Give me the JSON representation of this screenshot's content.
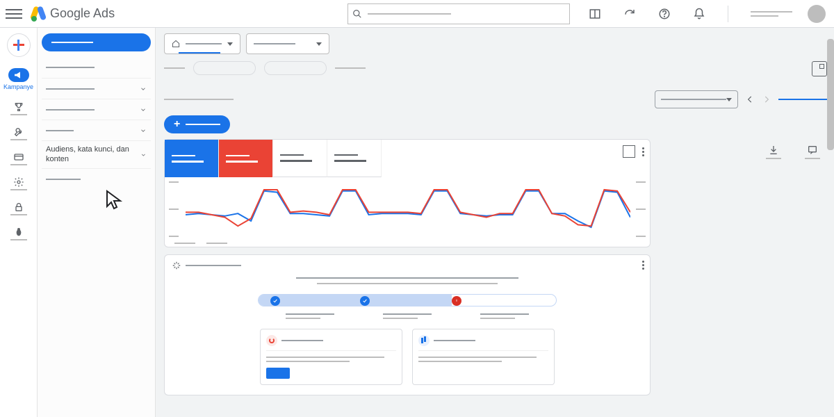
{
  "header": {
    "product_name_bold": "Google",
    "product_name_rest": " Ads",
    "search_placeholder": "",
    "icons": [
      "workspace-switch-icon",
      "refresh-icon",
      "help-icon",
      "notifications-icon"
    ]
  },
  "rail": {
    "items": [
      {
        "id": "kampanye",
        "label": "Kampanye",
        "icon": "megaphone-icon",
        "active": true
      },
      {
        "id": "goals",
        "label": "",
        "icon": "trophy-icon"
      },
      {
        "id": "tools",
        "label": "",
        "icon": "wrench-icon"
      },
      {
        "id": "billing",
        "label": "",
        "icon": "card-icon"
      },
      {
        "id": "admin",
        "label": "",
        "icon": "gear-icon"
      },
      {
        "id": "security",
        "label": "",
        "icon": "lock-icon"
      },
      {
        "id": "debug",
        "label": "",
        "icon": "bug-icon"
      }
    ]
  },
  "sidebar": {
    "items": [
      {
        "label": "",
        "type": "primary"
      },
      {
        "label": "",
        "expandable": false,
        "sep": false
      },
      {
        "label": "",
        "expandable": true
      },
      {
        "label": "",
        "expandable": true
      },
      {
        "label": "",
        "expandable": true
      },
      {
        "label": "Audiens, kata kunci, dan konten",
        "expandable": true
      },
      {
        "label": "",
        "expandable": false,
        "sep": true
      }
    ]
  },
  "toolbar": {
    "account_dropdown": "",
    "scope_dropdown": "",
    "date_range": "",
    "new_button_label": "",
    "download_label": "",
    "feedback_label": ""
  },
  "metrics": {
    "tabs": [
      {
        "id": "m1",
        "color": "blue"
      },
      {
        "id": "m2",
        "color": "red"
      },
      {
        "id": "m3",
        "color": "plain"
      },
      {
        "id": "m4",
        "color": "plain"
      }
    ]
  },
  "chart_data": {
    "type": "line",
    "x": [
      0,
      1,
      2,
      3,
      4,
      5,
      6,
      7,
      8,
      9,
      10,
      11,
      12,
      13,
      14,
      15,
      16,
      17,
      18,
      19,
      20,
      21,
      22,
      23,
      24,
      25,
      26,
      27,
      28,
      29,
      30,
      31,
      32,
      33,
      34
    ],
    "series": [
      {
        "name": "metric-1",
        "color": "#1a73e8",
        "values": [
          40,
          42,
          40,
          38,
          42,
          30,
          78,
          76,
          42,
          42,
          40,
          38,
          78,
          78,
          40,
          42,
          42,
          42,
          40,
          78,
          78,
          42,
          40,
          38,
          40,
          40,
          78,
          78,
          42,
          42,
          30,
          20,
          78,
          76,
          36
        ]
      },
      {
        "name": "metric-2",
        "color": "#ea4335",
        "values": [
          44,
          44,
          40,
          36,
          22,
          34,
          80,
          80,
          44,
          46,
          44,
          40,
          80,
          80,
          44,
          44,
          44,
          44,
          42,
          80,
          80,
          44,
          40,
          36,
          42,
          42,
          80,
          80,
          42,
          38,
          24,
          22,
          80,
          78,
          44
        ]
      }
    ],
    "ylim": [
      0,
      100
    ]
  },
  "recommendations": {
    "progress_pct": 65,
    "markers": [
      {
        "pos": 4,
        "state": "done"
      },
      {
        "pos": 34,
        "state": "done"
      },
      {
        "pos": 65,
        "state": "error"
      }
    ],
    "cards": [
      {
        "icon": "r"
      },
      {
        "icon": "b"
      }
    ]
  }
}
